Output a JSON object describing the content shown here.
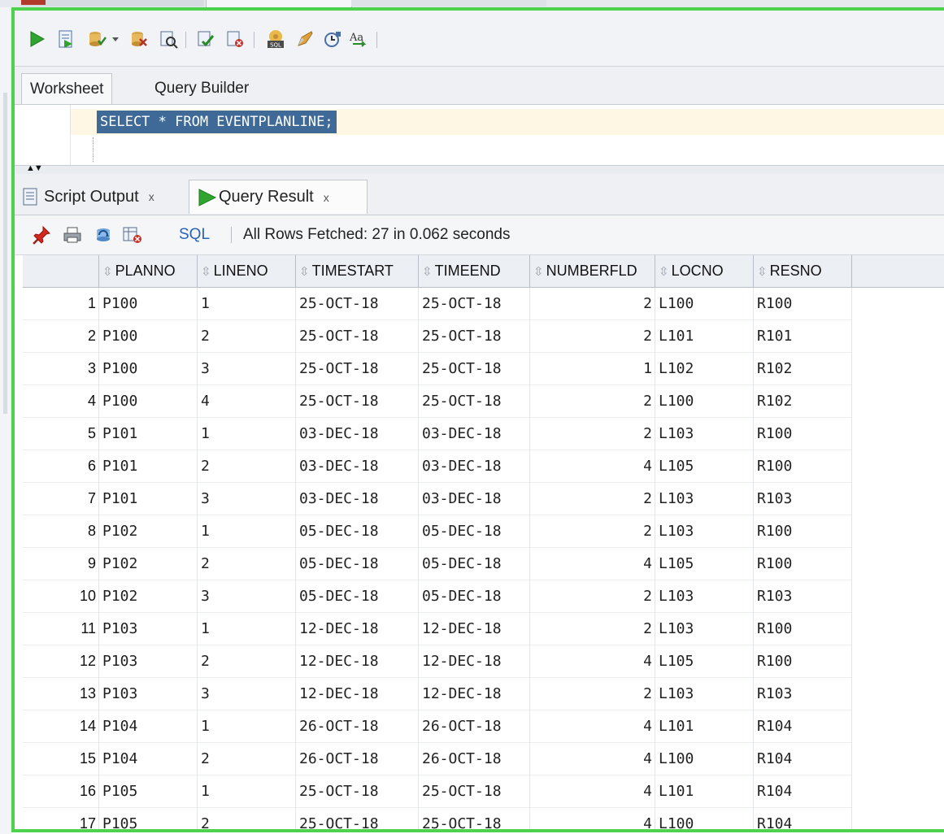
{
  "toolbar": {
    "icons": [
      "run-statement-icon",
      "run-script-icon",
      "commit-icon",
      "dropdown-arrow-icon",
      "autotrace-icon",
      "explain-plan-icon",
      "sql-tuning-icon",
      "rollback-icon",
      "sql-history-icon",
      "clear-icon",
      "format-icon",
      "case-toggle-icon"
    ]
  },
  "worksheet_tabs": {
    "worksheet": "Worksheet",
    "query_builder": "Query Builder"
  },
  "editor": {
    "sql": "SELECT * FROM EVENTPLANLINE;"
  },
  "result_tabs": {
    "script_output": "Script Output",
    "query_result": "Query Result",
    "close": "x"
  },
  "result_toolbar": {
    "sql_label": "SQL",
    "status": "All Rows Fetched: 27 in 0.062 seconds"
  },
  "grid": {
    "columns": [
      "PLANNO",
      "LINENO",
      "TIMESTART",
      "TIMEEND",
      "NUMBERFLD",
      "LOCNO",
      "RESNO"
    ],
    "rows": [
      [
        "1",
        "P100",
        "1",
        "25-OCT-18",
        "25-OCT-18",
        "2",
        "L100",
        "R100"
      ],
      [
        "2",
        "P100",
        "2",
        "25-OCT-18",
        "25-OCT-18",
        "2",
        "L101",
        "R101"
      ],
      [
        "3",
        "P100",
        "3",
        "25-OCT-18",
        "25-OCT-18",
        "1",
        "L102",
        "R102"
      ],
      [
        "4",
        "P100",
        "4",
        "25-OCT-18",
        "25-OCT-18",
        "2",
        "L100",
        "R102"
      ],
      [
        "5",
        "P101",
        "1",
        "03-DEC-18",
        "03-DEC-18",
        "2",
        "L103",
        "R100"
      ],
      [
        "6",
        "P101",
        "2",
        "03-DEC-18",
        "03-DEC-18",
        "4",
        "L105",
        "R100"
      ],
      [
        "7",
        "P101",
        "3",
        "03-DEC-18",
        "03-DEC-18",
        "2",
        "L103",
        "R103"
      ],
      [
        "8",
        "P102",
        "1",
        "05-DEC-18",
        "05-DEC-18",
        "2",
        "L103",
        "R100"
      ],
      [
        "9",
        "P102",
        "2",
        "05-DEC-18",
        "05-DEC-18",
        "4",
        "L105",
        "R100"
      ],
      [
        "10",
        "P102",
        "3",
        "05-DEC-18",
        "05-DEC-18",
        "2",
        "L103",
        "R103"
      ],
      [
        "11",
        "P103",
        "1",
        "12-DEC-18",
        "12-DEC-18",
        "2",
        "L103",
        "R100"
      ],
      [
        "12",
        "P103",
        "2",
        "12-DEC-18",
        "12-DEC-18",
        "4",
        "L105",
        "R100"
      ],
      [
        "13",
        "P103",
        "3",
        "12-DEC-18",
        "12-DEC-18",
        "2",
        "L103",
        "R103"
      ],
      [
        "14",
        "P104",
        "1",
        "26-OCT-18",
        "26-OCT-18",
        "4",
        "L101",
        "R104"
      ],
      [
        "15",
        "P104",
        "2",
        "26-OCT-18",
        "26-OCT-18",
        "4",
        "L100",
        "R104"
      ],
      [
        "16",
        "P105",
        "1",
        "25-OCT-18",
        "25-OCT-18",
        "4",
        "L101",
        "R104"
      ],
      [
        "17",
        "P105",
        "2",
        "25-OCT-18",
        "25-OCT-18",
        "4",
        "L100",
        "R104"
      ]
    ]
  },
  "colors": {
    "selection_frame": "#4dd24d",
    "sql_selection": "#3f6a97",
    "run_green": "#2fa52f",
    "link_blue": "#2a62b8"
  }
}
